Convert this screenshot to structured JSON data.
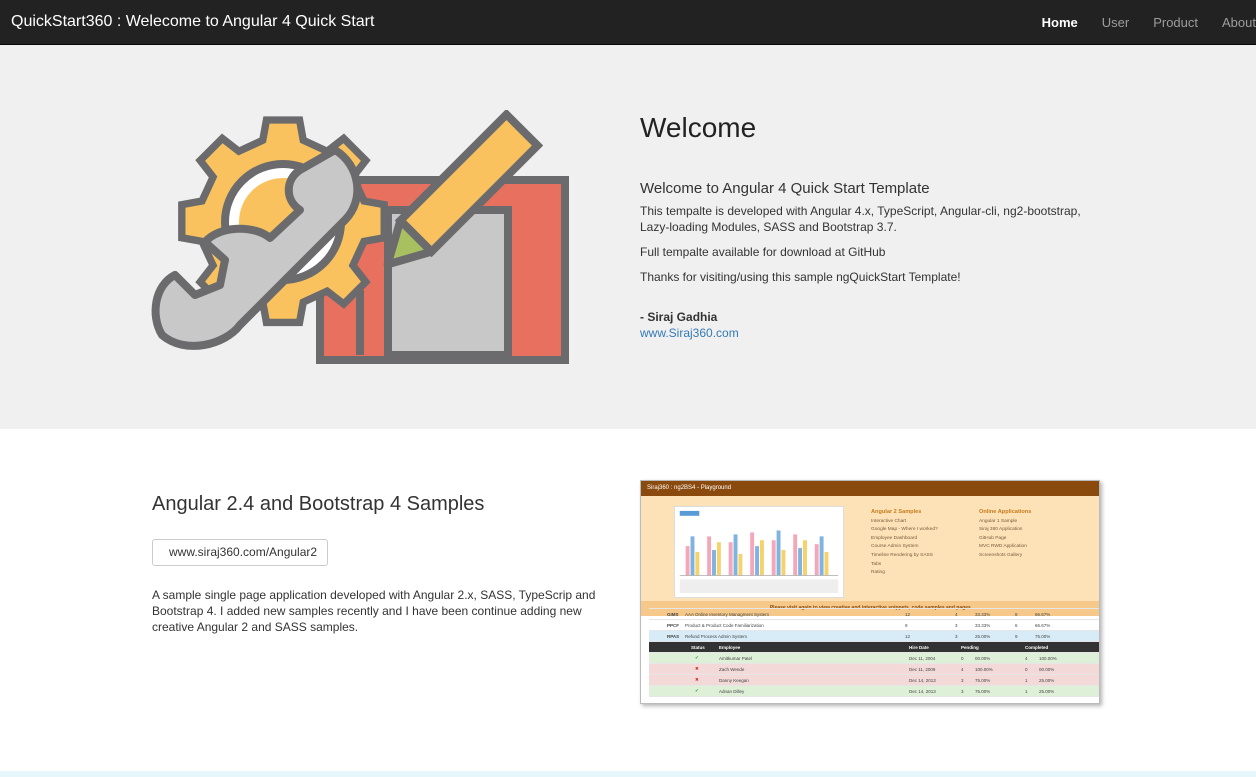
{
  "navbar": {
    "brand": "QuickStart360 : Welecome to Angular 4 Quick Start",
    "items": [
      {
        "label": "Home",
        "active": true
      },
      {
        "label": "User",
        "active": false
      },
      {
        "label": "Product",
        "active": false
      },
      {
        "label": "About",
        "active": false
      }
    ]
  },
  "hero": {
    "title": "Welcome",
    "subtitle": "Welcome to Angular 4 Quick Start Template",
    "paragraph1": "This tempalte is developed with Angular 4.x, TypeScript, Angular-cli, ng2-bootstrap, Lazy-loading Modules, SASS and Bootstrap 3.7.",
    "paragraph2": "Full tempalte available for download at GitHub",
    "paragraph3": "Thanks for visiting/using this sample ngQuickStart Template!",
    "signature": "- Siraj Gadhia",
    "website": "www.Siraj360.com",
    "illustration_icon": "settings-wrench-pencil-icon"
  },
  "samples": {
    "title": "Angular 2.4 and Bootstrap 4 Samples",
    "link_label": "www.siraj360.com/Angular2",
    "description": "A sample single page application developed with Angular 2.x, SASS, TypeScrip and Bootstrap 4. I added new samples recently and I have been continue adding new creative Angular 2 and SASS samples."
  },
  "screenshot": {
    "bar_title": "Siraj360 : ng2BS4 - Playground",
    "menu_col1_title": "Angular 2 Samples",
    "menu_col1": [
      "Interactive Chart",
      "Google Map - Where I worked?",
      "Employee Dashboard",
      "Course Admin System",
      "Timeline Rendering by SASS",
      "Tabs",
      "Rating"
    ],
    "menu_col2_title": "Online Applications",
    "menu_col2": [
      "Angular 1 Sample",
      "Siraj 360 Application",
      "GitHub Page",
      "MVC RWD Application",
      "Screenshots Gallery"
    ],
    "note": "Please visit again to view creative and interactive snippets, code samples and pages.",
    "rows": [
      {
        "code": "GIMS",
        "name": "AAA Online Inventory Managment System",
        "a": "12",
        "b": "4",
        "c": "33.33%",
        "d": "8",
        "e": "66.67%"
      },
      {
        "code": "PPCF",
        "name": "Product & Product Code Familiarization",
        "a": "9",
        "b": "3",
        "c": "33.33%",
        "d": "6",
        "e": "66.67%"
      },
      {
        "code": "RPAS",
        "name": "Refund Process Admin System",
        "a": "12",
        "b": "3",
        "c": "25.00%",
        "d": "9",
        "e": "75.00%"
      }
    ],
    "head": [
      "Status",
      "Employee",
      "Hire Date",
      "Pending",
      "Completed"
    ],
    "emp_rows": [
      {
        "mark": "✔",
        "name": "Amitkumar Patel",
        "date": "Dec 11, 2004",
        "p": "0",
        "pp": "00.00%",
        "c": "4",
        "cp": "100.00%"
      },
      {
        "mark": "✖",
        "name": "Zach Wende",
        "date": "Dec 11, 2009",
        "p": "4",
        "pp": "100.00%",
        "c": "0",
        "cp": "00.00%"
      },
      {
        "mark": "✖",
        "name": "Danny Keegan",
        "date": "Dec 14, 2013",
        "p": "3",
        "pp": "75.00%",
        "c": "1",
        "cp": "25.00%"
      },
      {
        "mark": "✔",
        "name": "Adnan Dilley",
        "date": "Dec 14, 2013",
        "p": "3",
        "pp": "75.00%",
        "c": "1",
        "cp": "25.00%"
      }
    ]
  },
  "colors": {
    "navbar_bg": "#222222",
    "hero_bg": "#f0f0f0",
    "link": "#337ab7",
    "gear": "#f9c25e",
    "board": "#e8705f",
    "outline": "#6b6b6e"
  }
}
